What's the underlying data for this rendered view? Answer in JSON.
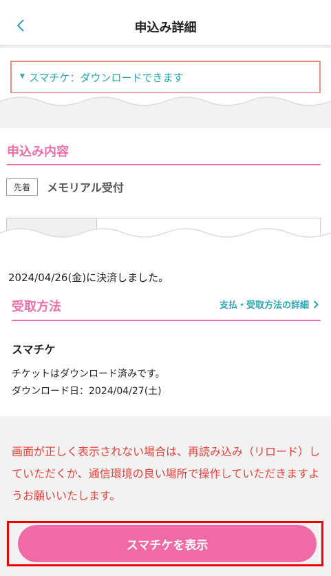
{
  "header": {
    "title": "申込み詳細"
  },
  "notice": {
    "text": "スマチケ：ダウンロードできます"
  },
  "application": {
    "section_title": "申込み内容",
    "tag": "先着",
    "tag_label": "メモリアル受付"
  },
  "payment": {
    "status": "2024/04/26(金)に決済しました。"
  },
  "receipt": {
    "section_title": "受取方法",
    "details_link": "支払・受取方法の詳細",
    "method": "スマチケ",
    "status_line": "チケットはダウンロード済みです。",
    "download_date": "ダウンロード日：2024/04/27(土)"
  },
  "warning": {
    "text": "画面が正しく表示されない場合は、再読み込み（リロード）していただくか、通信環境の良い場所で操作していただきますようお願いいたします。"
  },
  "actions": {
    "show_ticket": "スマチケを表示"
  },
  "colors": {
    "accent_pink": "#f06aa6",
    "teal": "#2aa6b2",
    "warning_red": "#e8413c"
  }
}
